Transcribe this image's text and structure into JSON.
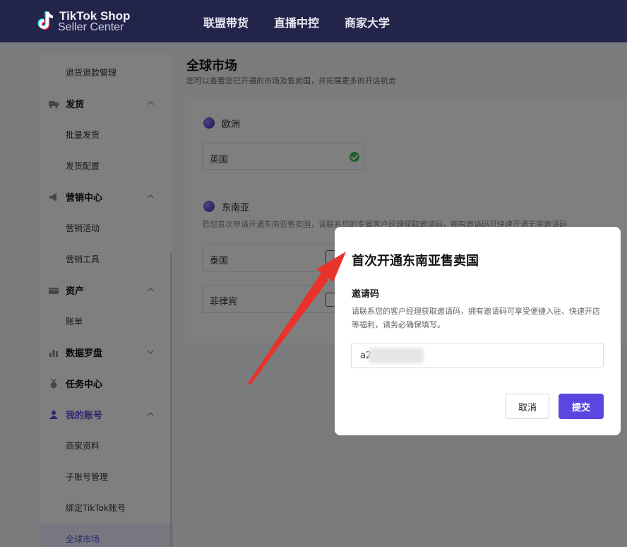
{
  "header": {
    "logo_line1": "TikTok Shop",
    "logo_line2": "Seller Center",
    "nav": [
      "联盟带货",
      "直播中控",
      "商家大学"
    ]
  },
  "sidebar": {
    "items": [
      {
        "type": "sub",
        "label": "退货退款管理"
      },
      {
        "type": "group",
        "label": "发货",
        "icon": "truck-icon",
        "chevron": "up"
      },
      {
        "type": "sub",
        "label": "批量发货"
      },
      {
        "type": "sub",
        "label": "发货配置"
      },
      {
        "type": "group",
        "label": "营销中心",
        "icon": "megaphone-icon",
        "chevron": "up"
      },
      {
        "type": "sub",
        "label": "营销活动"
      },
      {
        "type": "sub",
        "label": "营销工具"
      },
      {
        "type": "group",
        "label": "资产",
        "icon": "wallet-icon",
        "chevron": "up"
      },
      {
        "type": "sub",
        "label": "账单"
      },
      {
        "type": "group",
        "label": "数据罗盘",
        "icon": "bar-chart-icon",
        "chevron": "down"
      },
      {
        "type": "group",
        "label": "任务中心",
        "icon": "medal-icon",
        "chevron": ""
      },
      {
        "type": "group",
        "label": "我的账号",
        "icon": "user-icon",
        "chevron": "up",
        "active_group": true
      },
      {
        "type": "sub",
        "label": "商家资料"
      },
      {
        "type": "sub",
        "label": "子账号管理"
      },
      {
        "type": "sub",
        "label": "绑定TikTok账号"
      },
      {
        "type": "sub",
        "label": "全球市场",
        "active": true
      }
    ]
  },
  "page": {
    "title": "全球市场",
    "subtitle": "您可以查看您已开通的市场及售卖国，并拓展更多的开店机会"
  },
  "regions": {
    "europe": {
      "name": "欧洲",
      "markets": [
        "英国"
      ]
    },
    "sea": {
      "name": "东南亚",
      "note": "若您首次申请开通东南亚售卖国，请联系您的专属客户经理获取邀请码，拥有邀请码可快速开通无需邀请码",
      "markets": [
        "泰国",
        "菲律宾"
      ]
    }
  },
  "modal": {
    "title": "首次开通东南亚售卖国",
    "label": "邀请码",
    "description": "请联系您的客户经理获取邀请码，拥有邀请码可享受便捷入驻、快速开店等福利，请务必确保填写。",
    "input_value": "a2",
    "cancel_label": "取消",
    "submit_label": "提交"
  },
  "colors": {
    "topbar": "#22244a",
    "accent": "#5b47e0",
    "success": "#3fbf5a",
    "annotation_arrow": "#e8322b"
  }
}
